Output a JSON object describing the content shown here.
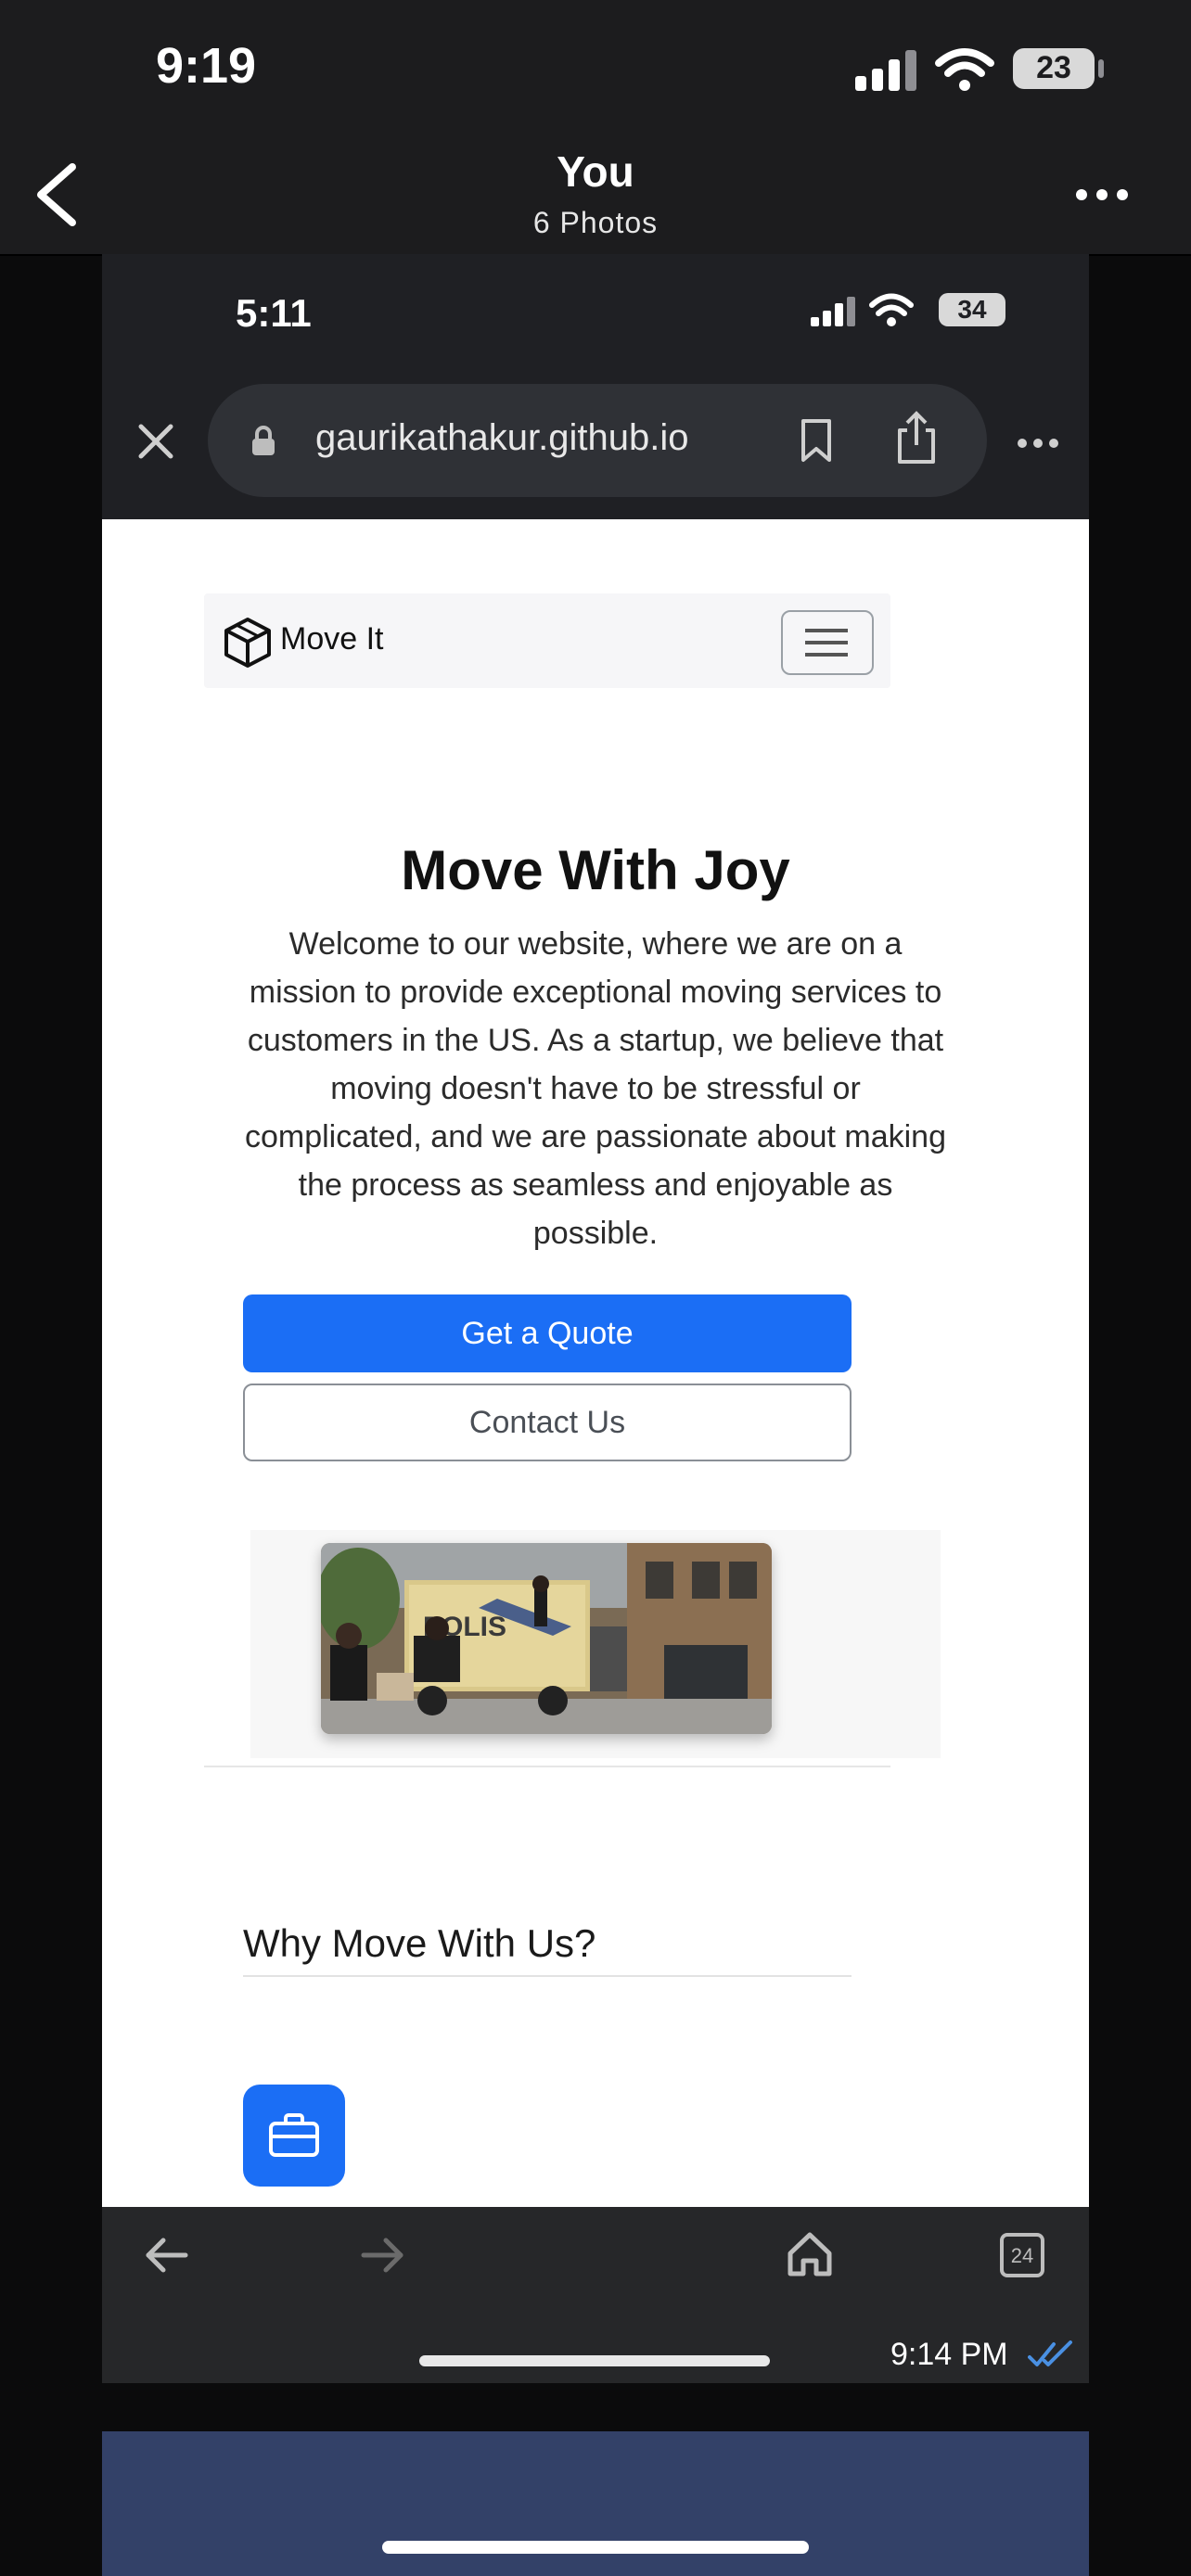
{
  "outer": {
    "time": "9:19",
    "battery": "23",
    "title": "You",
    "subtitle": "6 Photos"
  },
  "inner": {
    "time": "5:11",
    "battery": "34",
    "url": "gaurikathakur.github.io",
    "tab_count": "24",
    "message_time": "9:14 PM"
  },
  "site": {
    "brand": "Move It",
    "hero_title": "Move With Joy",
    "hero_text": "Welcome to our website, where we are on a mission to provide exceptional moving services to customers in the US. As a startup, we believe that moving doesn't have to be stressful or complicated, and we are passionate about making the process as seamless and enjoyable as possible.",
    "quote_button": "Get a Quote",
    "contact_button": "Contact Us",
    "truck_text": "POLIS",
    "section_title": "Why Move With Us?"
  },
  "colors": {
    "accent": "#1b6ef5",
    "outer_bar": "#1c1c1e",
    "inner_bar": "#1f2024",
    "next_card": "#334168"
  }
}
